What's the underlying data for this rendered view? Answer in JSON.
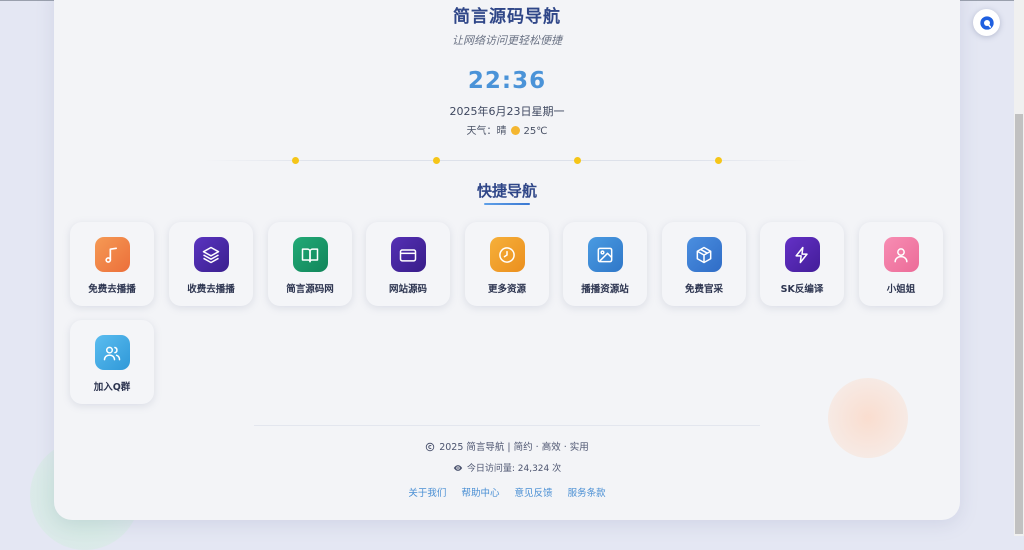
{
  "header": {
    "site_title": "简言源码导航",
    "subtitle": "让网络访问更轻松便捷",
    "clock": "22:36",
    "date": "2025年6月23日星期一",
    "weather_label": "天气：",
    "weather_condition": "晴",
    "temperature": "25℃"
  },
  "quick_nav": {
    "title": "快捷导航",
    "items": [
      {
        "label": "免费去播播",
        "icon": "music-note-icon",
        "color": "#f08a3e"
      },
      {
        "label": "收费去播播",
        "icon": "layers-icon",
        "color": "#4b2aa8"
      },
      {
        "label": "简言源码网",
        "icon": "book-icon",
        "color": "#1a9a6c"
      },
      {
        "label": "网站源码",
        "icon": "credit-card-icon",
        "color": "#4a23a0"
      },
      {
        "label": "更多资源",
        "icon": "clock-icon",
        "color": "#f0a32a"
      },
      {
        "label": "播播资源站",
        "icon": "image-icon",
        "color": "#3c8ad6"
      },
      {
        "label": "免费官采",
        "icon": "package-icon",
        "color": "#3d7fd4"
      },
      {
        "label": "SK反编译",
        "icon": "lightning-icon",
        "color": "#5b2bb8"
      },
      {
        "label": "小姐姐",
        "icon": "user-icon",
        "color": "#f07aa5"
      },
      {
        "label": "加入Q群",
        "icon": "users-icon",
        "color": "#3aa7e0"
      }
    ]
  },
  "footer": {
    "copyright": "2025 简言导航 | 简约 · 高效 · 实用",
    "visits": "今日访问量: 24,324 次",
    "links": [
      "关于我们",
      "帮助中心",
      "意见反馈",
      "服务条款"
    ]
  }
}
